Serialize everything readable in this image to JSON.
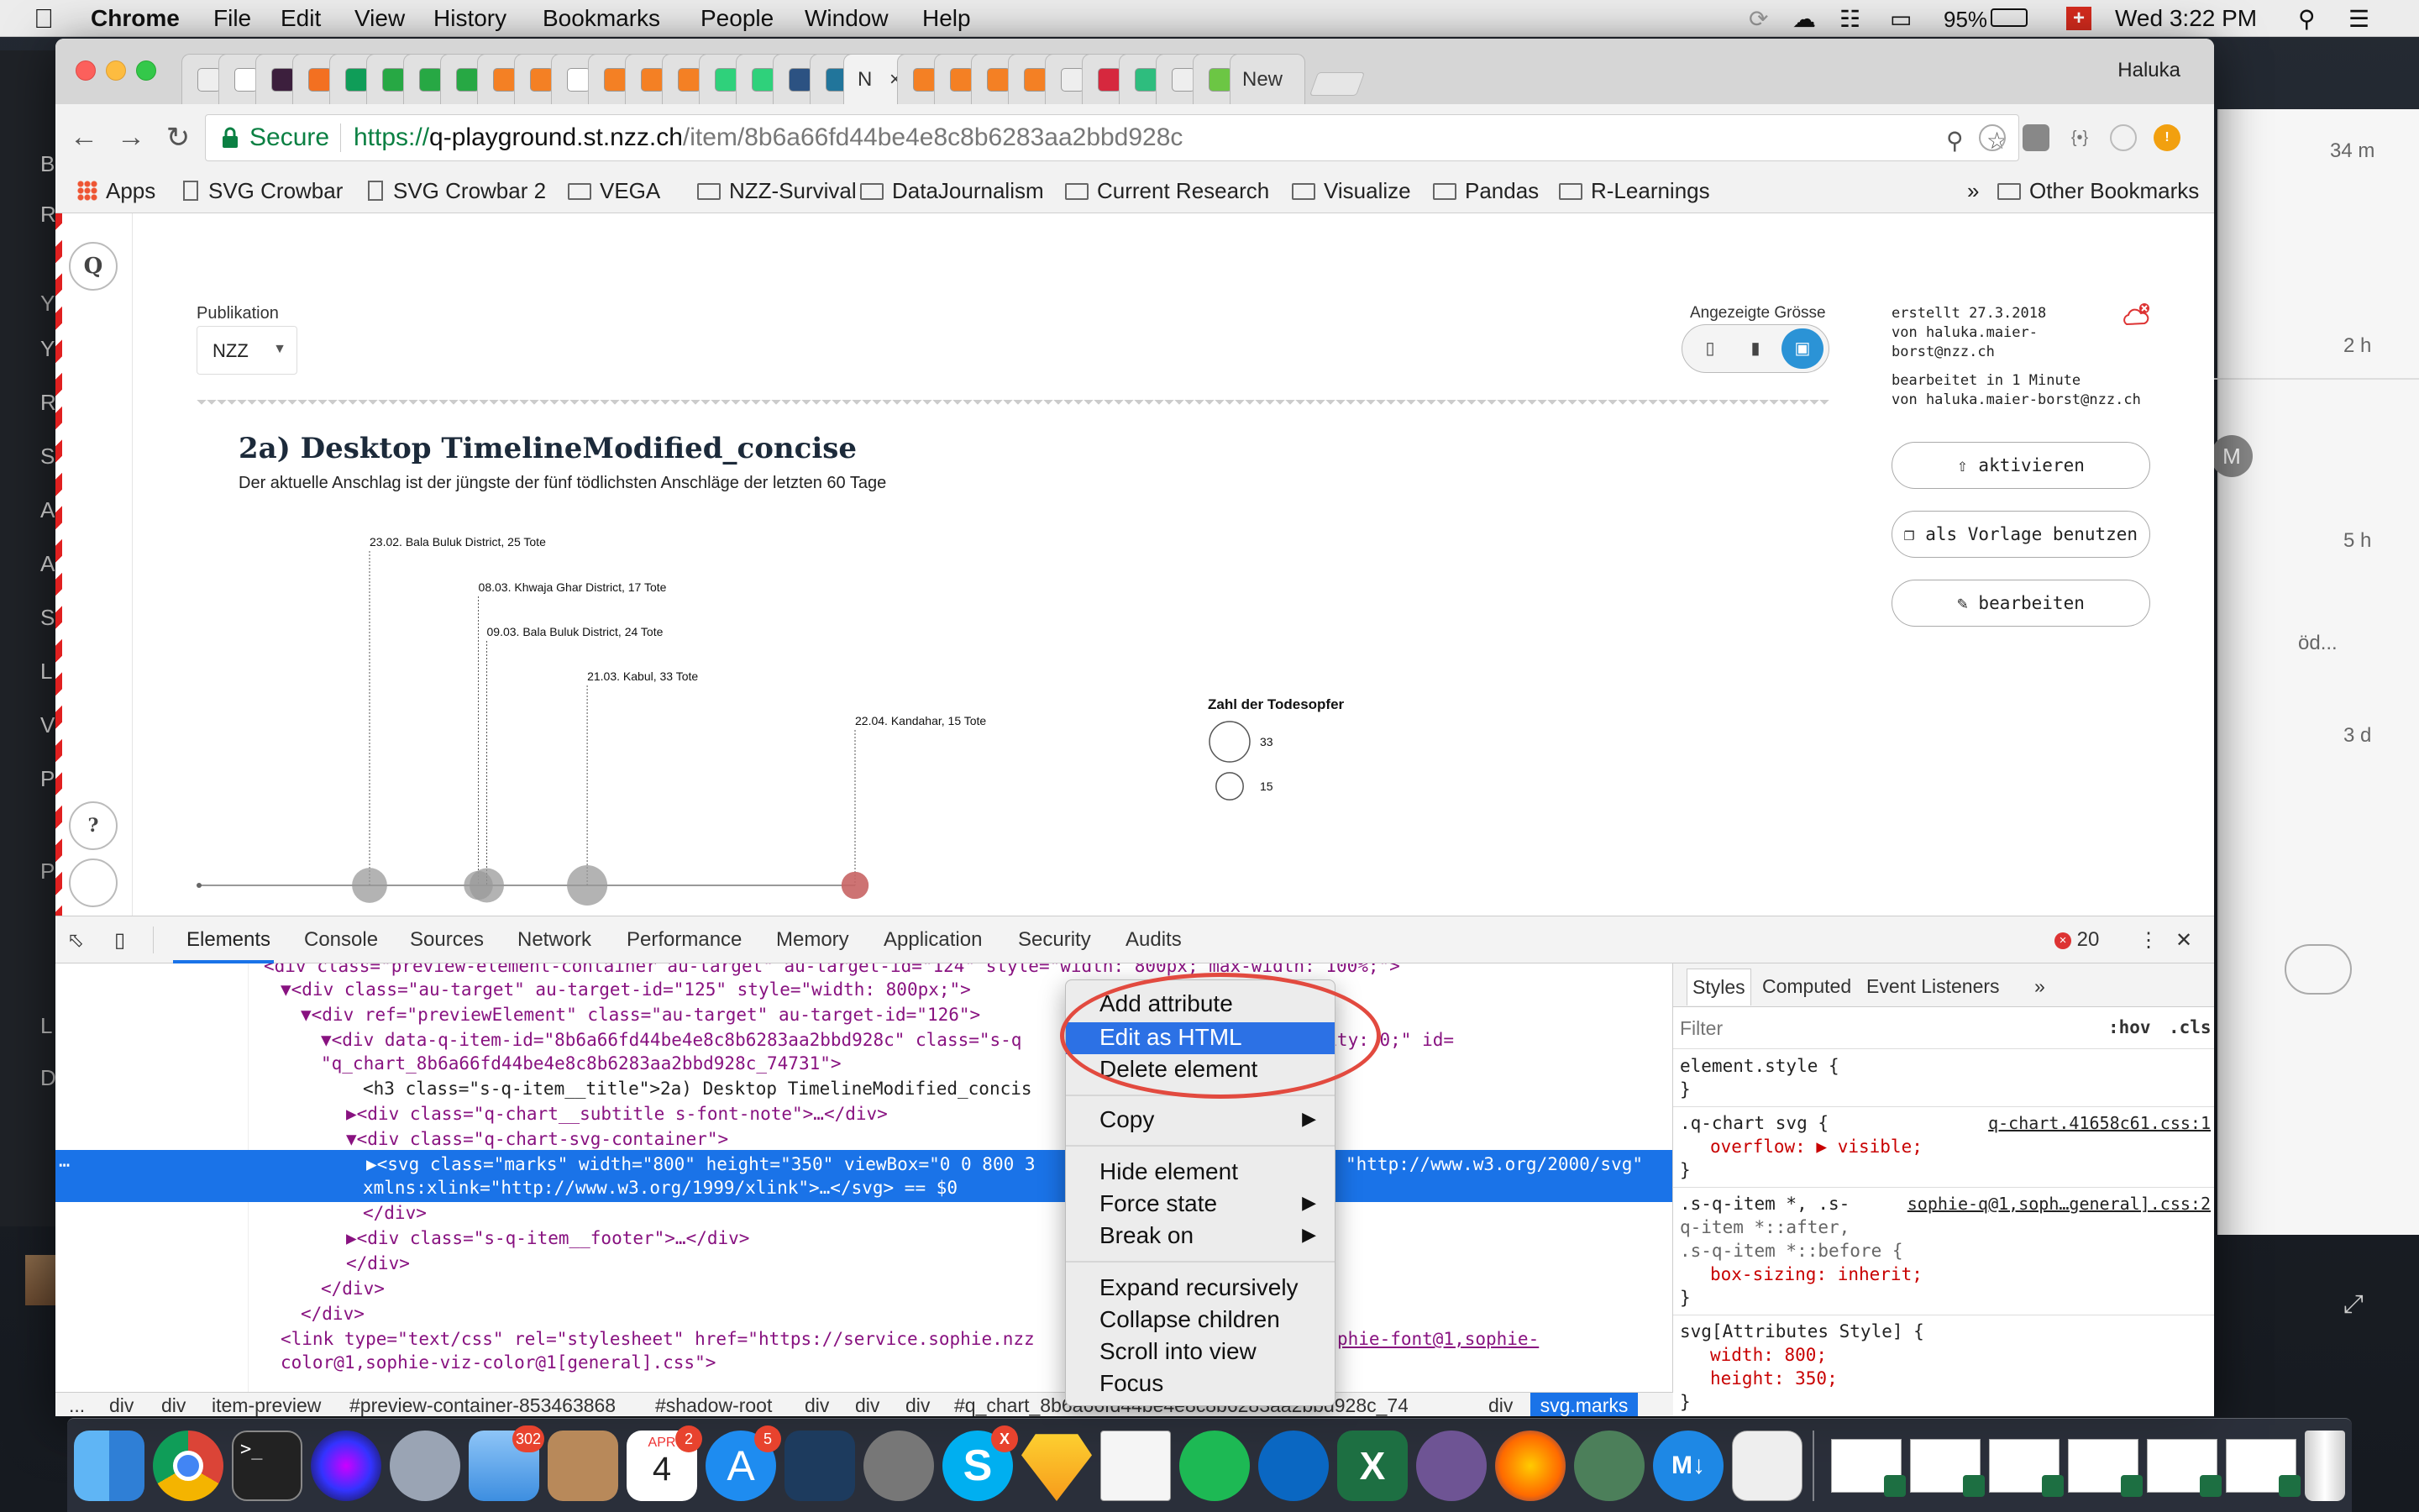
{
  "menubar": {
    "app": "Chrome",
    "menus": [
      "File",
      "Edit",
      "View",
      "History",
      "Bookmarks",
      "People",
      "Window",
      "Help"
    ],
    "battery": "95%",
    "clock": "Wed 3:22 PM"
  },
  "left_strip_letters": [
    "B",
    "R",
    "Y",
    "Y",
    "R",
    "S",
    "A",
    "A",
    "S",
    "L",
    "V",
    "P",
    "P",
    "L",
    "D"
  ],
  "right_panel": {
    "times": [
      "34 m",
      "2 h",
      "5 h",
      "3 d"
    ],
    "snippet": "öd...",
    "avatar": "M"
  },
  "tabs": {
    "active_label": "N",
    "last_label": "New",
    "profile": "Haluka"
  },
  "toolbar": {
    "secure": "Secure",
    "url_scheme": "https://",
    "url_host": "q-playground.st.nzz.ch",
    "url_path": "/item/8b6a66fd44be4e8c8b6283aa2bbd928c"
  },
  "bookmarks": {
    "items": [
      "Apps",
      "SVG Crowbar",
      "SVG Crowbar 2",
      "VEGA",
      "NZZ-Survival",
      "DataJournalism",
      "Current Research",
      "Visualize",
      "Pandas",
      "R-Learnings"
    ],
    "overflow": "»",
    "other": "Other Bookmarks"
  },
  "qapp": {
    "logo": "Q",
    "help": "?",
    "pub_label": "Publikation",
    "pub_value": "NZZ",
    "size_label": "Angezeigte Grösse",
    "meta_created": "erstellt 27.3.2018",
    "meta_by1": "von haluka.maier-",
    "meta_by2": "borst@nzz.ch",
    "meta_edited": "bearbeitet in 1 Minute",
    "meta_by3": "von haluka.maier-borst@nzz.ch",
    "btn_activate": "aktivieren",
    "btn_template": "als Vorlage benutzen",
    "btn_edit": "bearbeiten"
  },
  "chart_data": {
    "type": "scatter",
    "title": "2a) Desktop TimelineModified_concise",
    "subtitle": "Der aktuelle Anschlag ist der jüngste der fünf tödlichsten Anschläge der letzten 60 Tage",
    "legend_title": "Zahl der Todesopfer",
    "legend_values": [
      33,
      15
    ],
    "events": [
      {
        "date": "23.02.",
        "label": "23.02. Bala Buluk District, 25 Tote",
        "value": 25,
        "color": "#999999"
      },
      {
        "date": "08.03.",
        "label": "08.03. Khwaja Ghar District, 17 Tote",
        "value": 17,
        "color": "#999999"
      },
      {
        "date": "09.03.",
        "label": "09.03. Bala Buluk District, 24 Tote",
        "value": 24,
        "color": "#999999"
      },
      {
        "date": "21.03.",
        "label": "21.03. Kabul, 33 Tote",
        "value": 33,
        "color": "#999999"
      },
      {
        "date": "22.04.",
        "label": "22.04. Kandahar, 15 Tote",
        "value": 15,
        "color": "#c86464"
      }
    ]
  },
  "devtools": {
    "tabs": [
      "Elements",
      "Console",
      "Sources",
      "Network",
      "Performance",
      "Memory",
      "Application",
      "Security",
      "Audits"
    ],
    "errors": "20",
    "style_tabs": [
      "Styles",
      "Computed",
      "Event Listeners"
    ],
    "filter_placeholder": "Filter",
    "hov": ":hov",
    "cls": ".cls",
    "dom_lines": [
      "<div class=\"preview-element-container au-target\" au-target-id=\"124\" style=\"width: 800px; max-width: 100%;\">",
      "▼<div class=\"au-target\" au-target-id=\"125\" style=\"width: 800px;\">",
      "▼<div ref=\"previewElement\" class=\"au-target\" au-target-id=\"126\">",
      "▼<div data-q-item-id=\"8b6a66fd44be4e8c8b6283aa2bbd928c\" class=\"s-q",
      "\"q_chart_8b6a66fd44be4e8c8b6283aa2bbd928c_74731\">",
      "<h3 class=\"s-q-item__title\">2a) Desktop TimelineModified_concis",
      "▶<div class=\"q-chart__subtitle s-font-note\">…</div>",
      "▼<div class=\"q-chart-svg-container\">",
      "▶<svg class=\"marks\" width=\"800\" height=\"350\" viewBox=\"0 0 800 3",
      "xmlns:xlink=\"http://www.w3.org/1999/xlink\">…</svg> == $0",
      "</div>",
      "▶<div class=\"s-q-item__footer\">…</div>",
      "</div>",
      "</div>",
      "</div>",
      "<link type=\"text/css\" rel=\"stylesheet\" href=\"https://service.sophie.nzz",
      "color@1,sophie-viz-color@1[general].css\">"
    ],
    "dom_line3_tail": "acity: 0;\" id=",
    "dom_line8_tail": "\"http://www.w3.org/2000/svg\"",
    "dom_line15_tail": "phie-font@1,sophie-",
    "breadcrumbs": [
      "...",
      "div",
      "div",
      "item-preview",
      "#preview-container-853463868",
      "#shadow-root",
      "div",
      "div",
      "div",
      "#q_chart_8b6a66fd44be4e8c8b6283aa2bbd928c_74731",
      "div"
    ],
    "breadcrumb_last": "svg.marks",
    "styles": [
      {
        "sel": "element.style {",
        "props": []
      },
      {
        "sel": ".q-chart svg {",
        "link": "q-chart.41658c61.css:1",
        "props": [
          "overflow: ▶ visible;"
        ]
      },
      {
        "sel": ".s-q-item *, .s-",
        "link": "sophie-q@1,soph…general].css:2",
        "extra": [
          "q-item *::after,",
          ".s-q-item *::before {"
        ],
        "props": [
          "box-sizing: inherit;"
        ]
      },
      {
        "sel": "svg[Attributes Style] {",
        "props": [
          "width: 800;",
          "height: 350;"
        ]
      }
    ]
  },
  "context_menu": {
    "items": [
      "Add attribute",
      "Edit as HTML",
      "Delete element",
      "Copy",
      "Hide element",
      "Force state",
      "Break on",
      "Expand recursively",
      "Collapse children",
      "Scroll into view",
      "Focus"
    ],
    "highlighted": "Edit as HTML"
  },
  "dock": {
    "mail_badge": "302",
    "calendar_month": "APR",
    "calendar_day": "4",
    "appstore_badge": "5",
    "skype_badge": "X"
  }
}
